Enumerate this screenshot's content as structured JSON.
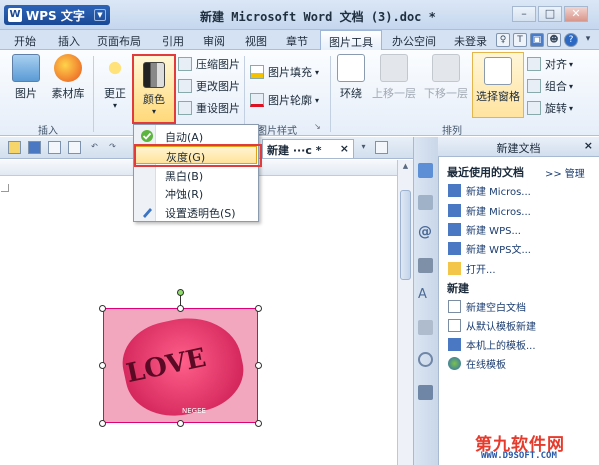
{
  "titlebar": {
    "app_name": "WPS 文字",
    "app_logo": "W",
    "doc_title": "新建 Microsoft Word 文档 (3).doc *"
  },
  "menubar": {
    "items": [
      "开始",
      "插入",
      "页面布局",
      "引用",
      "审阅",
      "视图",
      "章节",
      "图片工具",
      "办公空间"
    ],
    "active": "图片工具",
    "login": "未登录"
  },
  "ribbon": {
    "picture": "图片",
    "asset_lib": "素材库",
    "correct": "更正",
    "color": "颜色",
    "compress": "压缩图片",
    "change": "更改图片",
    "reset": "重设图片",
    "fill": "图片填充",
    "outline": "图片轮廓",
    "wrap": "环绕",
    "bring_forward": "上移一层",
    "send_backward": "下移一层",
    "selection_pane": "选择窗格",
    "align": "对齐",
    "group": "组合",
    "rotate": "旋转",
    "group_insert": "插入",
    "group_style": "图片样式",
    "group_arrange": "排列"
  },
  "dropdown": {
    "items": [
      {
        "label": "自动(A)"
      },
      {
        "label": "灰度(G)"
      },
      {
        "label": "黑白(B)"
      },
      {
        "label": "冲蚀(R)"
      },
      {
        "label": "设置透明色(S)"
      }
    ],
    "selected_index": 1
  },
  "doctab": {
    "label": "新建 ···c *",
    "close": "×"
  },
  "taskpane": {
    "title": "新建文档",
    "recent_title": "最近使用的文档",
    "manage": "管理",
    "recent": [
      "新建 Micros...",
      "新建 Micros...",
      "新建 WPS...",
      "新建 WPS文...",
      "打开..."
    ],
    "new_title": "新建",
    "new_items": [
      "新建空白文档",
      "从默认模板新建",
      "本机上的模板...",
      "在线模板"
    ]
  },
  "picture": {
    "text": "LOVE",
    "caption": "NEGEE"
  },
  "watermark": {
    "line1": "第九软件网",
    "line2": "WWW.D9SOFT.COM"
  }
}
